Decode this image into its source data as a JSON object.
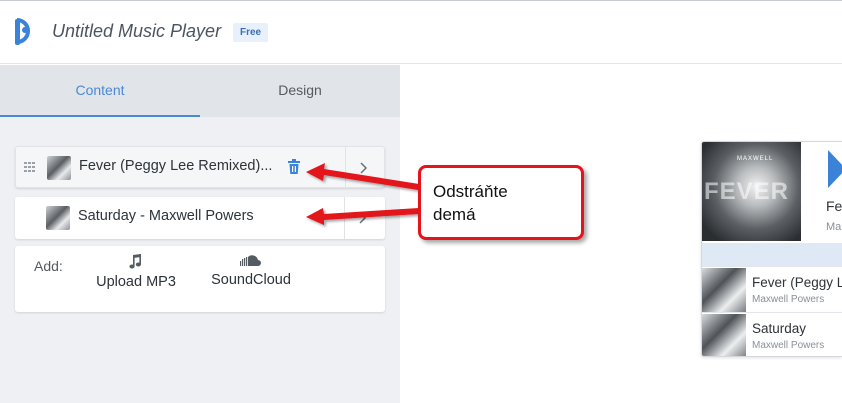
{
  "header": {
    "app_title": "Untitled Music Player",
    "plan_badge": "Free",
    "logo_icon": "music-player-logo-icon",
    "accent_color": "#4a8ad4"
  },
  "tabs": [
    {
      "label": "Content",
      "active": true
    },
    {
      "label": "Design",
      "active": false
    }
  ],
  "tracks": [
    {
      "label": "Fever (Peggy Lee Remixed)...",
      "selected": true
    },
    {
      "label": "Saturday - Maxwell Powers",
      "selected": false
    }
  ],
  "add": {
    "label": "Add:",
    "options": [
      {
        "label": "Upload MP3",
        "icon": "music-note-icon"
      },
      {
        "label": "SoundCloud",
        "icon": "soundcloud-icon"
      }
    ]
  },
  "callout": {
    "line1": "Odstráňte",
    "line2": "demá",
    "border_color": "#e3141b"
  },
  "player": {
    "cover_text": "FEVER",
    "cover_sub": "MAXWELL",
    "now_playing_title": "Fe",
    "now_playing_artist": "Ma",
    "playlist": [
      {
        "title": "Fever (Peggy L",
        "artist": "Maxwell Powers"
      },
      {
        "title": "Saturday",
        "artist": "Maxwell Powers"
      }
    ]
  }
}
